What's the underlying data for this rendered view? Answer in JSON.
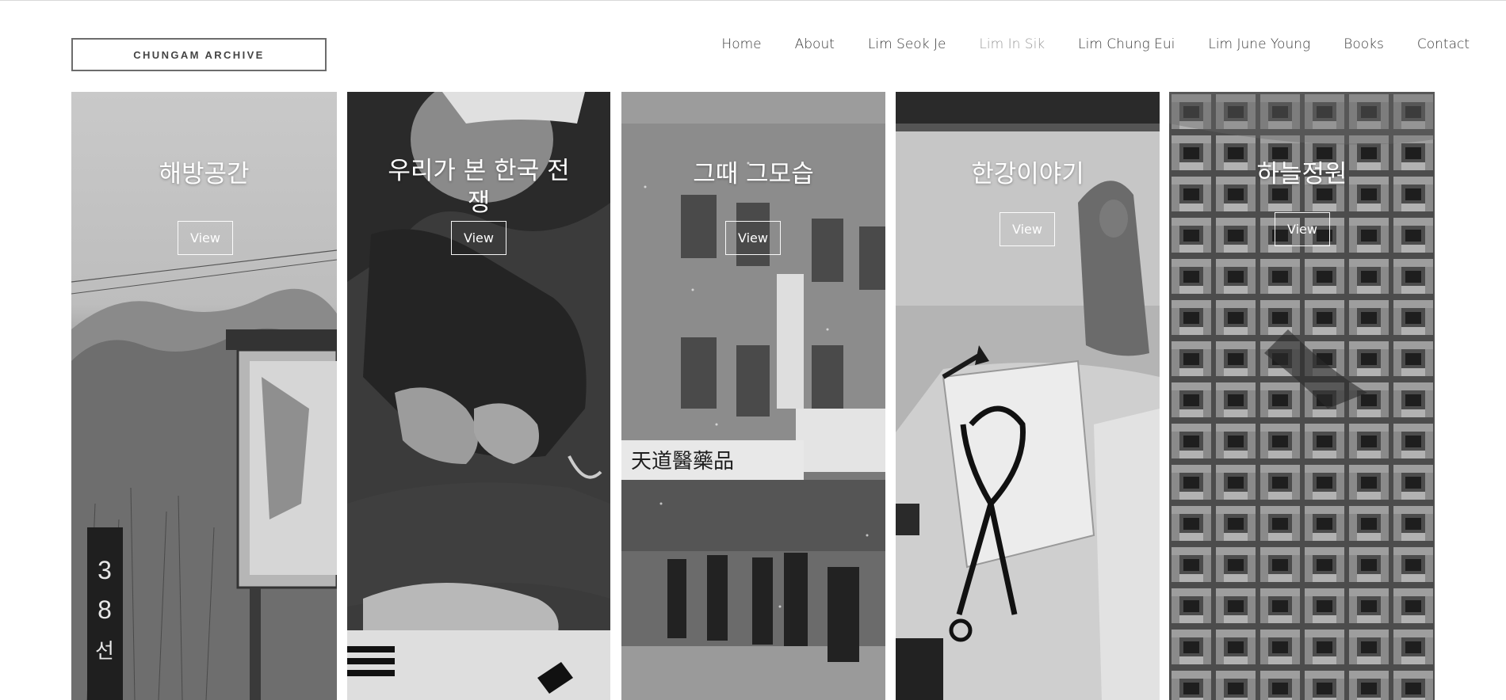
{
  "header": {
    "logo_text": "CHUNGAM ARCHIVE",
    "nav": [
      {
        "label": "Home",
        "active": false
      },
      {
        "label": "About",
        "active": false
      },
      {
        "label": "Lim Seok Je",
        "active": false
      },
      {
        "label": "Lim In Sik",
        "active": true
      },
      {
        "label": "Lim Chung Eui",
        "active": false
      },
      {
        "label": "Lim June Young",
        "active": false
      },
      {
        "label": "Books",
        "active": false
      },
      {
        "label": "Contact",
        "active": false
      }
    ]
  },
  "gallery": {
    "cards": [
      {
        "title": "해방공간",
        "button_label": "View",
        "photo_icon": "grassland-38-parallel-sign-photo"
      },
      {
        "title": "우리가 본 한국 전쟁",
        "button_label": "View",
        "photo_icon": "soldier-with-flag-photo"
      },
      {
        "title": "그때 그모습",
        "button_label": "View",
        "photo_icon": "snowy-street-buildings-photo"
      },
      {
        "title": "한강이야기",
        "button_label": "View",
        "photo_icon": "ice-harvester-han-river-photo"
      },
      {
        "title": "하늘정원",
        "button_label": "View",
        "photo_icon": "aerial-hanok-rooftops-photo"
      }
    ]
  },
  "colors": {
    "nav_text": "#3a3a3a",
    "nav_active": "#9a9a9a",
    "logo_border": "#6c6c6c"
  }
}
